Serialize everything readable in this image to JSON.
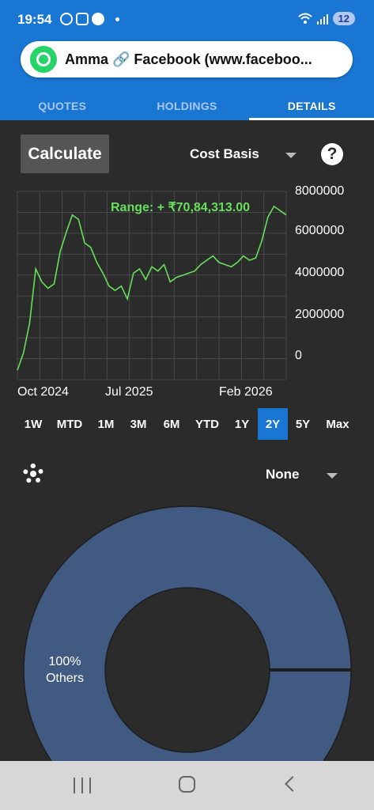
{
  "status_bar": {
    "time": "19:54",
    "battery": "12",
    "icons": [
      "whatsapp-icon",
      "screenshot-icon",
      "app-icon",
      "dot-icon",
      "wifi-icon",
      "signal-icon"
    ]
  },
  "notification": {
    "app_icon": "whatsapp-icon",
    "text": "Amma 🔗 Facebook (www.faceboo..."
  },
  "tabs": [
    {
      "label": "QUOTES",
      "active": false
    },
    {
      "label": "HOLDINGS",
      "active": false
    },
    {
      "label": "DETAILS",
      "active": true
    }
  ],
  "controls": {
    "calculate_label": "Calculate",
    "cost_basis_label": "Cost Basis",
    "help_label": "?"
  },
  "chart_data": {
    "type": "line",
    "range_label": "Range: + ₹70,84,313.00",
    "x_ticks": [
      "Oct 2024",
      "Jul 2025",
      "Feb 2026"
    ],
    "y_ticks": [
      "8000000",
      "6000000",
      "4000000",
      "2000000",
      "0"
    ],
    "ylim": [
      0,
      8000000
    ],
    "grid": true,
    "line_color": "#66e05a",
    "series": [
      {
        "x": [
          "2024-07",
          "2024-07",
          "2024-08",
          "2024-08",
          "2024-09",
          "2024-09",
          "2024-10",
          "2024-10",
          "2024-11",
          "2024-11",
          "2024-12",
          "2024-12",
          "2025-01",
          "2025-01",
          "2025-02",
          "2025-02",
          "2025-03",
          "2025-04",
          "2025-04",
          "2025-05",
          "2025-05",
          "2025-06",
          "2025-06",
          "2025-07",
          "2025-07",
          "2025-08",
          "2025-08",
          "2025-09",
          "2025-09",
          "2025-10",
          "2025-10",
          "2025-11",
          "2025-11",
          "2025-12",
          "2025-12",
          "2026-01",
          "2026-01",
          "2026-02",
          "2026-02",
          "2026-03",
          "2026-03",
          "2026-04",
          "2026-04",
          "2026-05",
          "2026-05"
        ],
        "values": [
          0,
          800000,
          2200000,
          4700000,
          4100000,
          3800000,
          4000000,
          5500000,
          6400000,
          7200000,
          7000000,
          5900000,
          5700000,
          5000000,
          4500000,
          3900000,
          3700000,
          3900000,
          3300000,
          4500000,
          4700000,
          4200000,
          4800000,
          4600000,
          4900000,
          4100000,
          4300000,
          4400000,
          4500000,
          4600000,
          4900000,
          5100000,
          5300000,
          5000000,
          4900000,
          4800000,
          5000000,
          5300000,
          5100000,
          5200000,
          6000000,
          7100000,
          7600000,
          7400000,
          7200000
        ]
      }
    ]
  },
  "periods": [
    {
      "label": "1W",
      "active": false
    },
    {
      "label": "MTD",
      "active": false
    },
    {
      "label": "1M",
      "active": false
    },
    {
      "label": "3M",
      "active": false
    },
    {
      "label": "6M",
      "active": false
    },
    {
      "label": "YTD",
      "active": false
    },
    {
      "label": "1Y",
      "active": false
    },
    {
      "label": "2Y",
      "active": true
    },
    {
      "label": "5Y",
      "active": false
    },
    {
      "label": "Max",
      "active": false
    }
  ],
  "breakdown": {
    "group_select": "None",
    "settings_icon": "gear-icon"
  },
  "pie": {
    "type": "pie",
    "slices": [
      {
        "label": "Others",
        "percent_label": "100%",
        "value": 100,
        "color": "#415a82"
      }
    ]
  },
  "nav_bar": {
    "icons": [
      "recent-apps-icon",
      "home-icon",
      "back-icon"
    ]
  }
}
